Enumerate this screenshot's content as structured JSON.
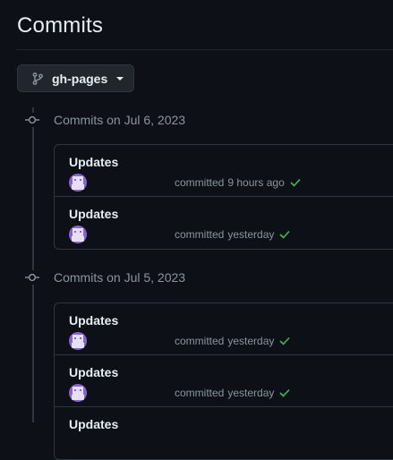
{
  "page": {
    "title": "Commits"
  },
  "branch": {
    "name": "gh-pages",
    "icon": "git-branch-icon"
  },
  "groups": [
    {
      "header": "Commits on Jul 6, 2023",
      "commits": [
        {
          "message": "Updates",
          "author": "",
          "action": "committed",
          "when": "9 hours ago",
          "status": "check"
        },
        {
          "message": "Updates",
          "author": "",
          "action": "committed",
          "when": "yesterday",
          "status": "check"
        }
      ]
    },
    {
      "header": "Commits on Jul 5, 2023",
      "commits": [
        {
          "message": "Updates",
          "author": "",
          "action": "committed",
          "when": "yesterday",
          "status": "check"
        },
        {
          "message": "Updates",
          "author": "",
          "action": "committed",
          "when": "yesterday",
          "status": "check"
        },
        {
          "message": "Updates",
          "author": "",
          "action": "",
          "when": "",
          "status": ""
        }
      ]
    }
  ],
  "colors": {
    "background": "#0d1117",
    "border": "#30363d",
    "text": "#e6edf3",
    "muted": "#8b949e",
    "success": "#3fb950",
    "redaction": "#e5141c"
  }
}
